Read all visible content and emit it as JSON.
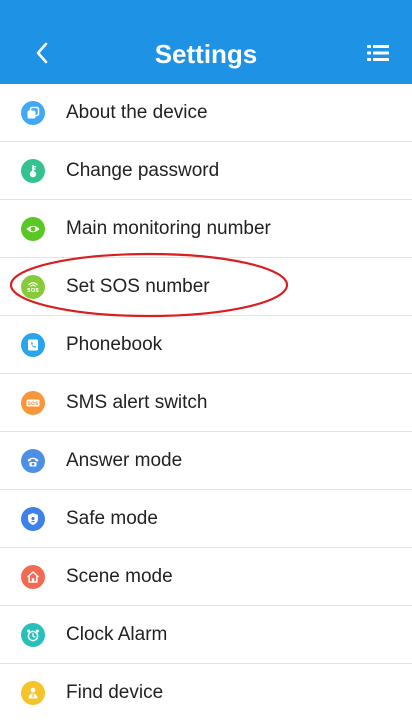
{
  "header": {
    "title": "Settings",
    "color": "#1e92e4",
    "back_icon": "chevron-left-icon",
    "menu_icon": "list-menu-icon"
  },
  "items": [
    {
      "label": "About the device",
      "icon": "device-info-icon",
      "color": "#3fa9f5"
    },
    {
      "label": "Change password",
      "icon": "key-icon",
      "color": "#34c38f"
    },
    {
      "label": "Main monitoring number",
      "icon": "eye-icon",
      "color": "#5ac724"
    },
    {
      "label": "Set SOS number",
      "icon": "sos-signal-icon",
      "color": "#86cc3a"
    },
    {
      "label": "Phonebook",
      "icon": "phonebook-icon",
      "color": "#2aa4ea"
    },
    {
      "label": "SMS alert switch",
      "icon": "sos-message-icon",
      "color": "#f7973a"
    },
    {
      "label": "Answer mode",
      "icon": "telephone-icon",
      "color": "#4e8fe6"
    },
    {
      "label": "Safe mode",
      "icon": "shield-icon",
      "color": "#3e82e8"
    },
    {
      "label": "Scene mode",
      "icon": "home-scene-icon",
      "color": "#f26a52"
    },
    {
      "label": "Clock Alarm",
      "icon": "alarm-clock-icon",
      "color": "#27c0bb"
    },
    {
      "label": "Find device",
      "icon": "user-find-icon",
      "color": "#f6c32a"
    }
  ],
  "annotation": {
    "highlight_color": "#d92020"
  }
}
